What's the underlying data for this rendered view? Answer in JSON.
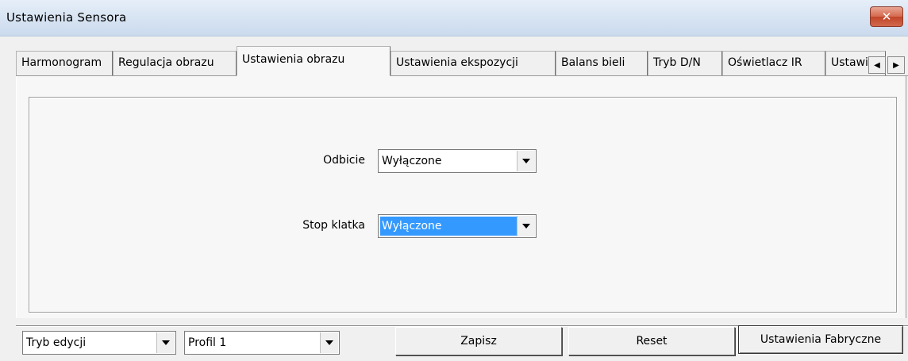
{
  "window": {
    "title": "Ustawienia Sensora",
    "close_glyph": "✕"
  },
  "tabs": [
    {
      "label": "Harmonogram",
      "active": false
    },
    {
      "label": "Regulacja obrazu",
      "active": false
    },
    {
      "label": "Ustawienia obrazu",
      "active": true
    },
    {
      "label": "Ustawienia ekspozycji",
      "active": false
    },
    {
      "label": "Balans bieli",
      "active": false
    },
    {
      "label": "Tryb D/N",
      "active": false
    },
    {
      "label": "Oświetlacz IR",
      "active": false
    },
    {
      "label": "Ustawie",
      "active": false
    }
  ],
  "tab_scroll": {
    "left_icon": "arrow-left-icon",
    "right_icon": "arrow-right-icon",
    "left_glyph": "◀",
    "right_glyph": "▶"
  },
  "fields": {
    "mirror": {
      "label": "Odbicie",
      "value": "Wyłączone"
    },
    "freeze": {
      "label": "Stop klatka",
      "value": "Wyłączone"
    }
  },
  "bottom": {
    "mode_value": "Tryb edycji",
    "profile_value": "Profil 1",
    "save_label": "Zapisz",
    "reset_label": "Reset",
    "factory_label": "Ustawienia Fabryczne"
  },
  "colors": {
    "selection": "#3399ff",
    "close_button": "#c2452a"
  }
}
